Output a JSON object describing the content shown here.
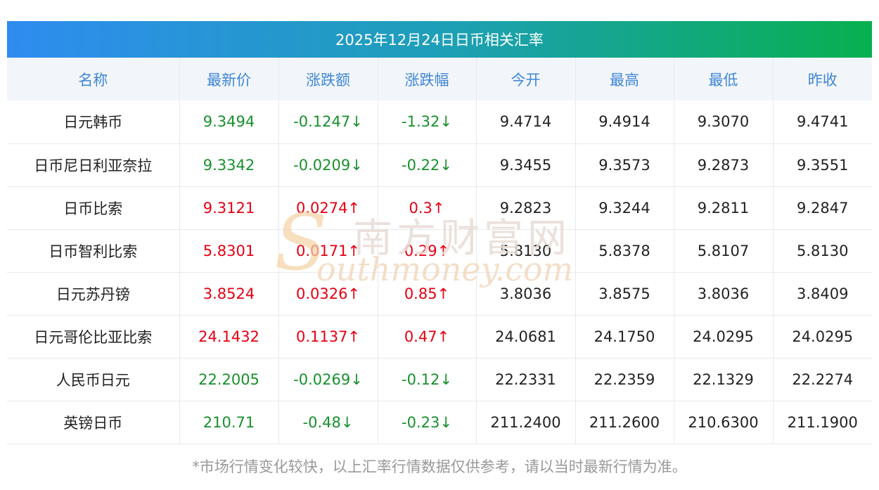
{
  "title": "2025年12月24日日币相关汇率",
  "headers": [
    "名称",
    "最新价",
    "涨跌额",
    "涨跌幅",
    "今开",
    "最高",
    "最低",
    "昨收"
  ],
  "rows": [
    {
      "name": "日元韩币",
      "latest": "9.3494",
      "change": "-0.1247↓",
      "pct": "-1.32↓",
      "open": "9.4714",
      "high": "9.4914",
      "low": "9.3070",
      "prev": "9.4741",
      "dir": "down"
    },
    {
      "name": "日币尼日利亚奈拉",
      "latest": "9.3342",
      "change": "-0.0209↓",
      "pct": "-0.22↓",
      "open": "9.3455",
      "high": "9.3573",
      "low": "9.2873",
      "prev": "9.3551",
      "dir": "down"
    },
    {
      "name": "日币比索",
      "latest": "9.3121",
      "change": "0.0274↑",
      "pct": "0.3↑",
      "open": "9.2823",
      "high": "9.3244",
      "low": "9.2811",
      "prev": "9.2847",
      "dir": "up"
    },
    {
      "name": "日币智利比索",
      "latest": "5.8301",
      "change": "0.0171↑",
      "pct": "0.29↑",
      "open": "5.8130",
      "high": "5.8378",
      "low": "5.8107",
      "prev": "5.8130",
      "dir": "up"
    },
    {
      "name": "日元苏丹镑",
      "latest": "3.8524",
      "change": "0.0326↑",
      "pct": "0.85↑",
      "open": "3.8036",
      "high": "3.8575",
      "low": "3.8036",
      "prev": "3.8409",
      "dir": "up"
    },
    {
      "name": "日元哥伦比亚比索",
      "latest": "24.1432",
      "change": "0.1137↑",
      "pct": "0.47↑",
      "open": "24.0681",
      "high": "24.1750",
      "low": "24.0295",
      "prev": "24.0295",
      "dir": "up"
    },
    {
      "name": "人民币日元",
      "latest": "22.2005",
      "change": "-0.0269↓",
      "pct": "-0.12↓",
      "open": "22.2331",
      "high": "22.2359",
      "low": "22.1329",
      "prev": "22.2274",
      "dir": "down"
    },
    {
      "name": "英镑日币",
      "latest": "210.71",
      "change": "-0.48↓",
      "pct": "-0.23↓",
      "open": "211.2400",
      "high": "211.2600",
      "low": "210.6300",
      "prev": "211.1900",
      "dir": "down"
    }
  ],
  "watermark": {
    "cn": "南方财富网",
    "en": "outhmoney.com",
    "s": "S"
  },
  "footnote": "*市场行情变化较快，以上汇率行情数据仅供参考，请以当时最新行情为准。",
  "colors": {
    "up": "#e60012",
    "down": "#18912c",
    "header_text": "#3f86d6"
  }
}
